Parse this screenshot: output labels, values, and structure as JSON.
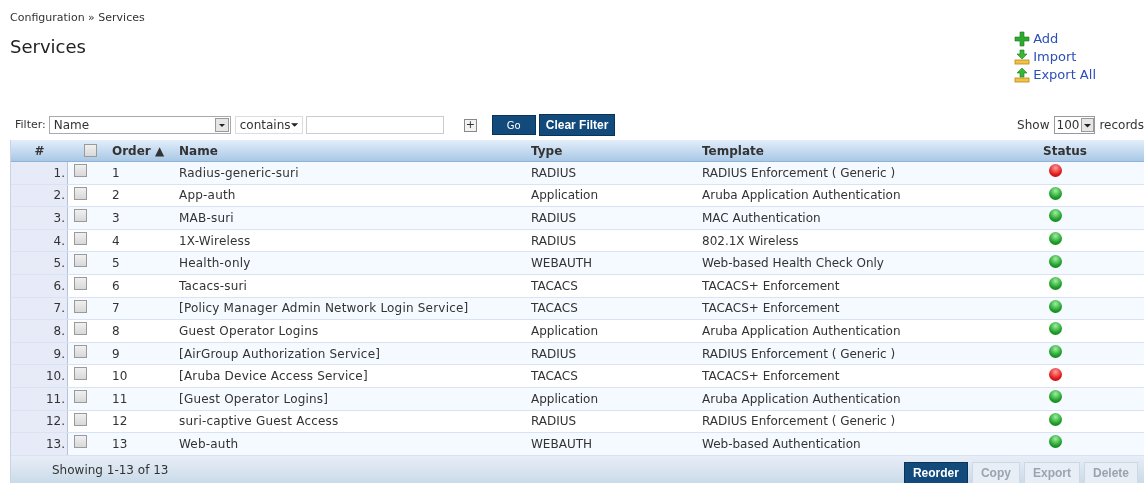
{
  "breadcrumb": "Configuration » Services",
  "title": "Services",
  "actions": [
    {
      "label": "Add",
      "kind": "add"
    },
    {
      "label": "Import",
      "kind": "import"
    },
    {
      "label": "Export All",
      "kind": "export"
    }
  ],
  "filter": {
    "label": "Filter:",
    "field": "Name",
    "operator": "contains",
    "go": "Go",
    "clear": "Clear Filter",
    "add_symbol": "+"
  },
  "show": {
    "label": "Show",
    "value": "100",
    "suffix": "records"
  },
  "table": {
    "all_checked": false,
    "columns": [
      "#",
      "Order ▲",
      "Name",
      "Type",
      "Template",
      "Status"
    ],
    "rows": [
      {
        "index": "1.",
        "order": "1",
        "name": "Radius-generic-suri",
        "type": "RADIUS",
        "template": "RADIUS Enforcement ( Generic )",
        "enabled": false,
        "checked": false
      },
      {
        "index": "2.",
        "order": "2",
        "name": "App-auth",
        "type": "Application",
        "template": "Aruba Application Authentication",
        "enabled": true,
        "checked": false
      },
      {
        "index": "3.",
        "order": "3",
        "name": "MAB-suri",
        "type": "RADIUS",
        "template": "MAC Authentication",
        "enabled": true,
        "checked": false
      },
      {
        "index": "4.",
        "order": "4",
        "name": "1X-Wireless",
        "type": "RADIUS",
        "template": "802.1X Wireless",
        "enabled": true,
        "checked": false
      },
      {
        "index": "5.",
        "order": "5",
        "name": "Health-only",
        "type": "WEBAUTH",
        "template": "Web-based Health Check Only",
        "enabled": true,
        "checked": false
      },
      {
        "index": "6.",
        "order": "6",
        "name": "Tacacs-suri",
        "type": "TACACS",
        "template": "TACACS+ Enforcement",
        "enabled": true,
        "checked": false
      },
      {
        "index": "7.",
        "order": "7",
        "name": "[Policy Manager Admin Network Login Service]",
        "type": "TACACS",
        "template": "TACACS+ Enforcement",
        "enabled": true,
        "checked": false
      },
      {
        "index": "8.",
        "order": "8",
        "name": "Guest Operator Logins",
        "type": "Application",
        "template": "Aruba Application Authentication",
        "enabled": true,
        "checked": false
      },
      {
        "index": "9.",
        "order": "9",
        "name": "[AirGroup Authorization Service]",
        "type": "RADIUS",
        "template": "RADIUS Enforcement ( Generic )",
        "enabled": true,
        "checked": false
      },
      {
        "index": "10.",
        "order": "10",
        "name": "[Aruba Device Access Service]",
        "type": "TACACS",
        "template": "TACACS+ Enforcement",
        "enabled": false,
        "checked": false
      },
      {
        "index": "11.",
        "order": "11",
        "name": "[Guest Operator Logins]",
        "type": "Application",
        "template": "Aruba Application Authentication",
        "enabled": true,
        "checked": false
      },
      {
        "index": "12.",
        "order": "12",
        "name": "suri-captive Guest Access",
        "type": "RADIUS",
        "template": "RADIUS Enforcement ( Generic )",
        "enabled": true,
        "checked": false
      },
      {
        "index": "13.",
        "order": "13",
        "name": "Web-auth",
        "type": "WEBAUTH",
        "template": "Web-based Authentication",
        "enabled": true,
        "checked": false
      }
    ]
  },
  "footer": {
    "summary": "Showing 1-13 of 13",
    "buttons": [
      {
        "label": "Reorder",
        "disabled": false
      },
      {
        "label": "Copy",
        "disabled": true
      },
      {
        "label": "Export",
        "disabled": true
      },
      {
        "label": "Delete",
        "disabled": true
      }
    ]
  }
}
